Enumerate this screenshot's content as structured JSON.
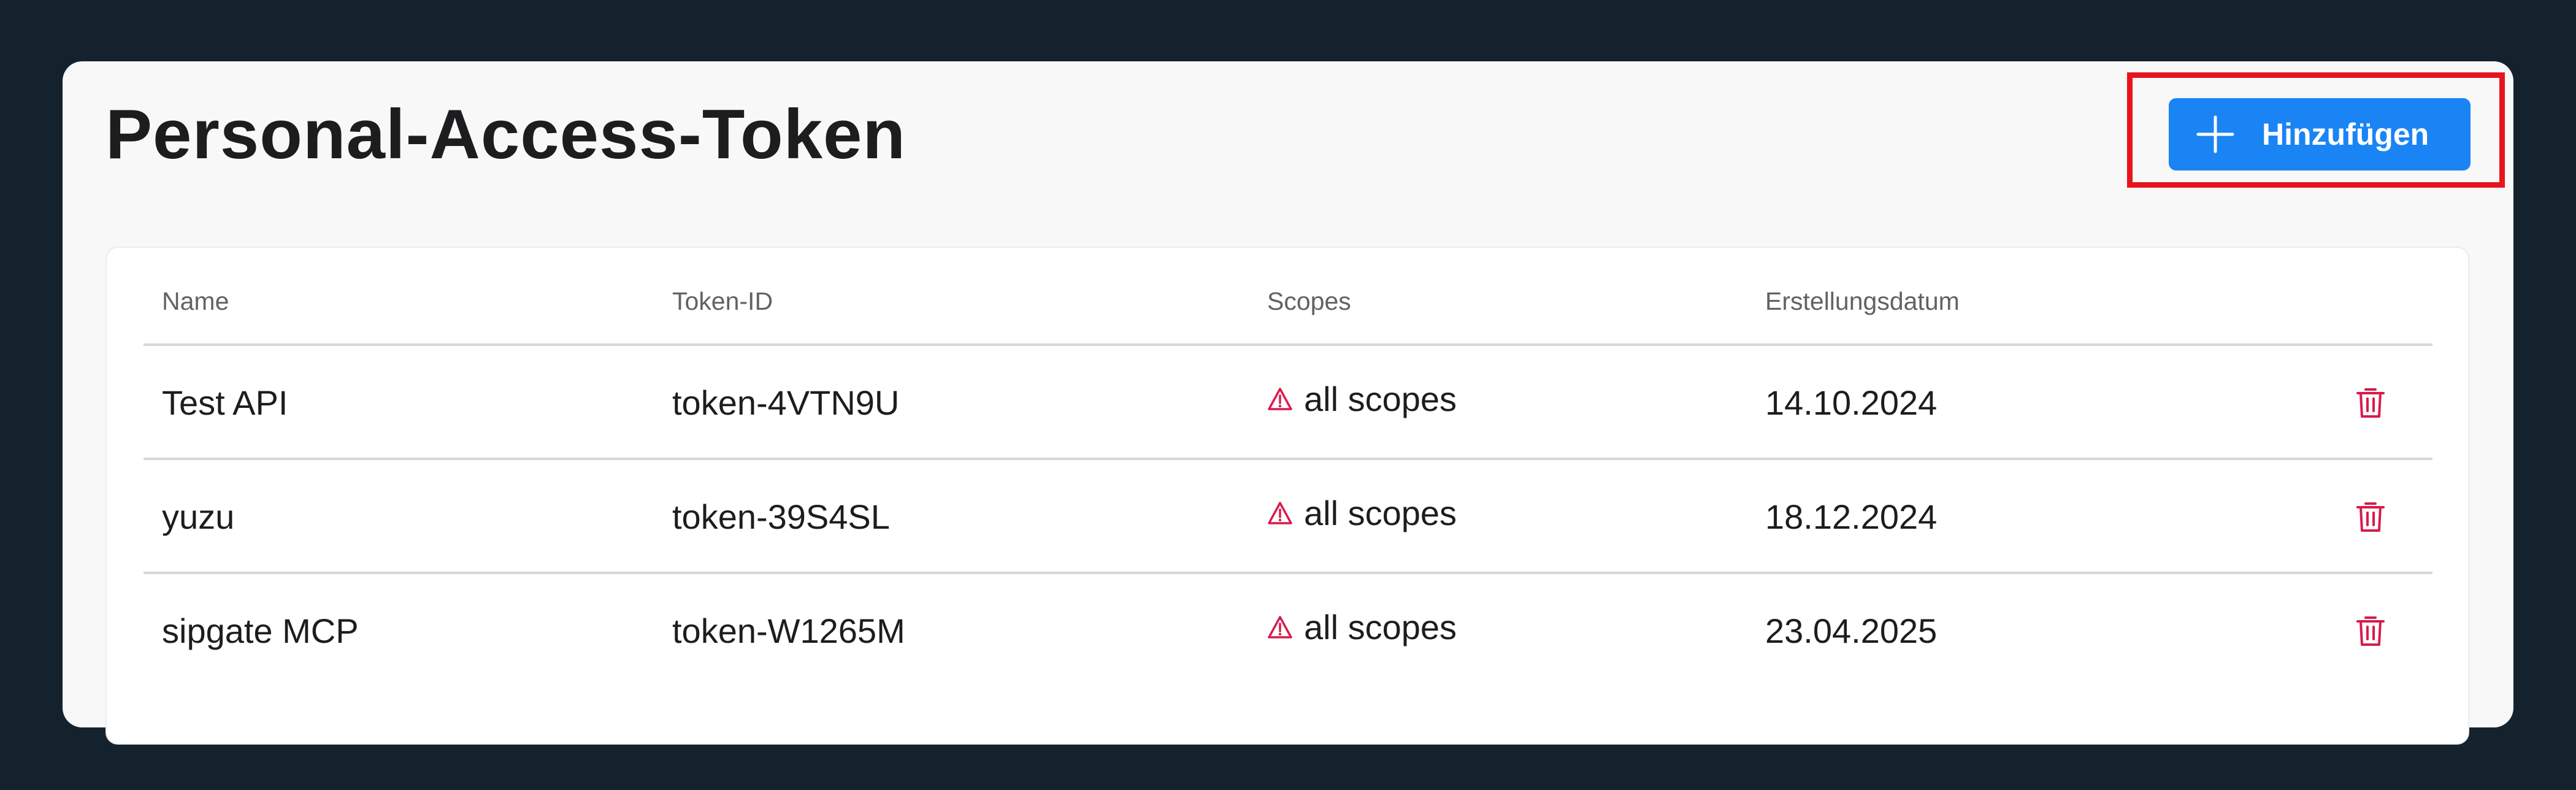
{
  "page": {
    "title": "Personal-Access-Token",
    "add_button_label": "Hinzufügen"
  },
  "table": {
    "columns": [
      "Name",
      "Token-ID",
      "Scopes",
      "Erstellungsdatum"
    ],
    "rows": [
      {
        "name": "Test API",
        "token_id": "token-4VTN9U",
        "scopes": "all scopes",
        "created": "14.10.2024"
      },
      {
        "name": "yuzu",
        "token_id": "token-39S4SL",
        "scopes": "all scopes",
        "created": "18.12.2024"
      },
      {
        "name": "sipgate MCP",
        "token_id": "token-W1265M",
        "scopes": "all scopes",
        "created": "23.04.2025"
      }
    ]
  },
  "icons": {
    "add": "plus-icon",
    "scope_warning": "warning-triangle-icon",
    "delete": "trash-icon"
  },
  "colors": {
    "background": "#13222d",
    "panel": "#f8f8f8",
    "primary_button": "#1a84f4",
    "highlight_border": "#e8141d",
    "danger": "#d81b4a",
    "text": "#1d1d1f",
    "header_text": "#606266"
  }
}
